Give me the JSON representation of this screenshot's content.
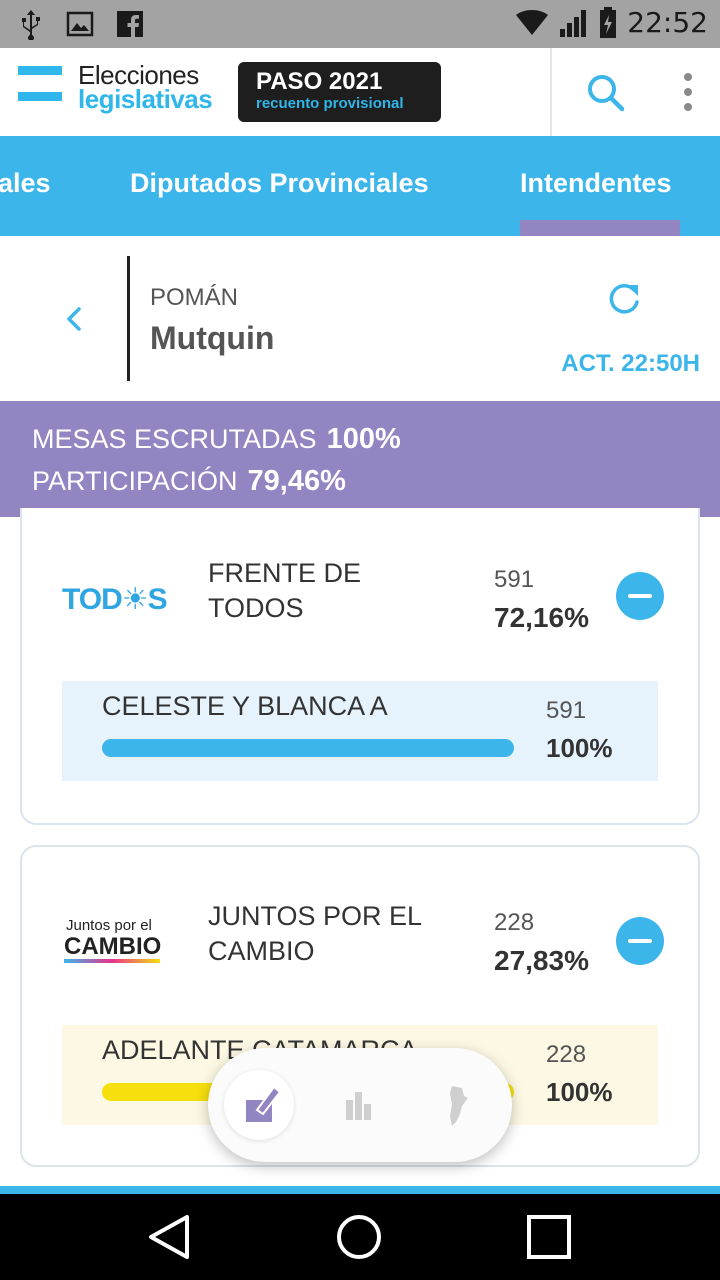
{
  "status_bar": {
    "time": "22:52",
    "icons": [
      "usb-icon",
      "image-icon",
      "facebook-icon",
      "wifi-icon",
      "signal-icon",
      "battery-icon"
    ]
  },
  "header": {
    "logo_line1": "Elecciones",
    "logo_line2": "legislativas",
    "badge_title": "PASO 2021",
    "badge_subtitle": "recuento provisional",
    "search_icon": "search-icon",
    "menu_icon": "more-vert-icon"
  },
  "tabs": [
    {
      "label": "ales",
      "active": false
    },
    {
      "label": "Diputados Provinciales",
      "active": false
    },
    {
      "label": "Intendentes",
      "active": true
    }
  ],
  "location": {
    "province": "POMÁN",
    "name": "Mutquin",
    "updated": "ACT. 22:50H"
  },
  "stats": {
    "mesas_label": "MESAS ESCRUTADAS",
    "mesas_value": "100%",
    "participacion_label": "PARTICIPACIÓN",
    "participacion_value": "79,46%"
  },
  "parties": [
    {
      "logo_text": "TOD☀S",
      "name_line1": "FRENTE DE",
      "name_line2": "TODOS",
      "votes": "591",
      "percent": "72,16%",
      "list": {
        "name": "CELESTE Y BLANCA A",
        "votes": "591",
        "percent": "100%",
        "fraction": 1.0,
        "bg": "#e6f3fc",
        "bar_color": "#3bb5ea"
      }
    },
    {
      "logo_text_top": "Juntos por el",
      "logo_text_bottom": "CAMBIO",
      "name_line1": "JUNTOS POR EL",
      "name_line2": "CAMBIO",
      "votes": "228",
      "percent": "27,83%",
      "list": {
        "name": "ADELANTE CATAMARCA",
        "votes": "228",
        "percent": "100%",
        "fraction": 1.0,
        "bg": "#fdf8e3",
        "bar_color": "#f6df0d"
      }
    }
  ],
  "floating_nav": [
    "vote-icon",
    "bar-chart-icon",
    "argentina-map-icon"
  ],
  "system_nav": [
    "back-icon",
    "home-icon",
    "recents-icon"
  ],
  "colors": {
    "accent": "#3bb5ea",
    "purple": "#9384c2"
  }
}
